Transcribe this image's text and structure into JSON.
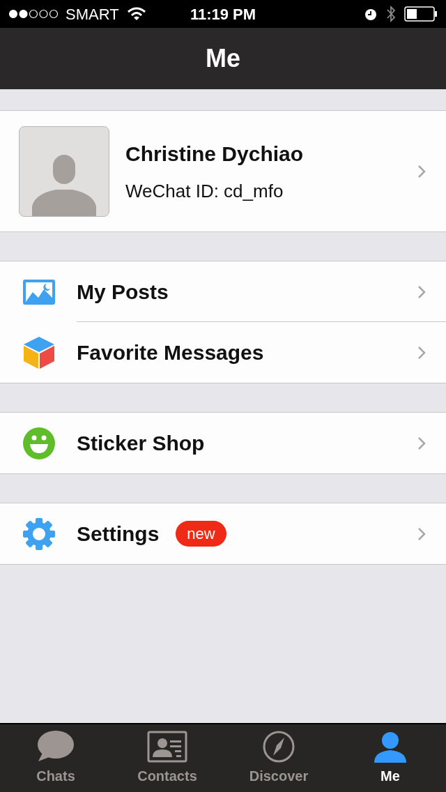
{
  "status_bar": {
    "carrier": "SMART",
    "time": "11:19 PM"
  },
  "nav": {
    "title": "Me"
  },
  "profile": {
    "name": "Christine Dychiao",
    "wechat_id": "WeChat ID: cd_mfo"
  },
  "groups": [
    {
      "items": [
        {
          "kind": "posts",
          "label": "My Posts"
        },
        {
          "kind": "favorites",
          "label": "Favorite Messages"
        }
      ]
    },
    {
      "items": [
        {
          "kind": "stickers",
          "label": "Sticker Shop"
        }
      ]
    },
    {
      "items": [
        {
          "kind": "settings",
          "label": "Settings",
          "badge": "new"
        }
      ]
    }
  ],
  "tabs": [
    {
      "kind": "chats",
      "label": "Chats",
      "selected": false
    },
    {
      "kind": "contacts",
      "label": "Contacts",
      "selected": false
    },
    {
      "kind": "discover",
      "label": "Discover",
      "selected": false
    },
    {
      "kind": "me",
      "label": "Me",
      "selected": true
    }
  ]
}
